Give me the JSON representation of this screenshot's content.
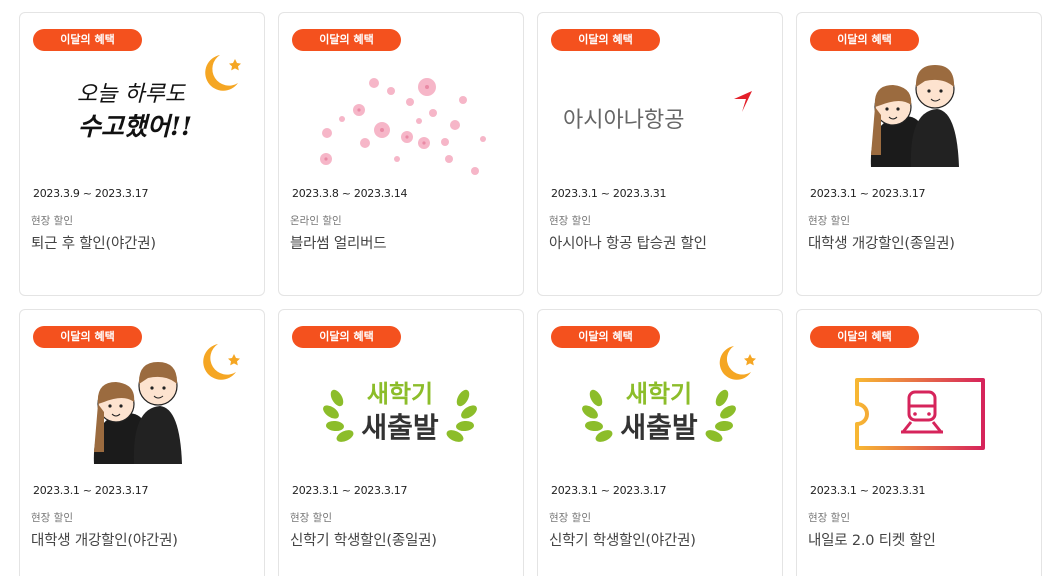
{
  "colors": {
    "badge": "#f4511e",
    "moon": "#f5a623",
    "asiana_red": "#e3202a",
    "leaf": "#8cbd2a"
  },
  "cards": [
    {
      "badge": "이달의 혜택",
      "date": "2023.3.9 ~ 2023.3.17",
      "category": "현장 할인",
      "title": "퇴근 후 할인(야간권)",
      "image_text": [
        "오늘 하루도",
        "수고했어!!"
      ],
      "icons": [
        "moon-icon"
      ]
    },
    {
      "badge": "이달의 혜택",
      "date": "2023.3.8 ~ 2023.3.14",
      "category": "온라인 할인",
      "title": "블라썸 얼리버드",
      "icons": [
        "cherry-blossom-icon"
      ]
    },
    {
      "badge": "이달의 혜택",
      "date": "2023.3.1 ~ 2023.3.31",
      "category": "현장 할인",
      "title": "아시아나 항공 탑승권 할인",
      "image_text": [
        "아시아나항공"
      ],
      "icons": [
        "asiana-logo"
      ]
    },
    {
      "badge": "이달의 혜택",
      "date": "2023.3.1 ~ 2023.3.17",
      "category": "현장 할인",
      "title": "대학생 개강할인(종일권)",
      "icons": [
        "students-illustration"
      ]
    },
    {
      "badge": "이달의 혜택",
      "date": "2023.3.1 ~ 2023.3.17",
      "category": "현장 할인",
      "title": "대학생 개강할인(야간권)",
      "icons": [
        "students-illustration",
        "moon-icon"
      ]
    },
    {
      "badge": "이달의 혜택",
      "date": "2023.3.1 ~ 2023.3.17",
      "category": "현장 할인",
      "title": "신학기 학생할인(종일권)",
      "image_text": [
        "새학기",
        "새출발"
      ],
      "icons": [
        "laurel-icon"
      ]
    },
    {
      "badge": "이달의 혜택",
      "date": "2023.3.1 ~ 2023.3.17",
      "category": "현장 할인",
      "title": "신학기 학생할인(야간권)",
      "image_text": [
        "새학기",
        "새출발"
      ],
      "icons": [
        "laurel-icon",
        "moon-icon"
      ]
    },
    {
      "badge": "이달의 혜택",
      "date": "2023.3.1 ~ 2023.3.31",
      "category": "현장 할인",
      "title": "내일로 2.0 티켓 할인",
      "icons": [
        "train-ticket-icon"
      ]
    }
  ]
}
